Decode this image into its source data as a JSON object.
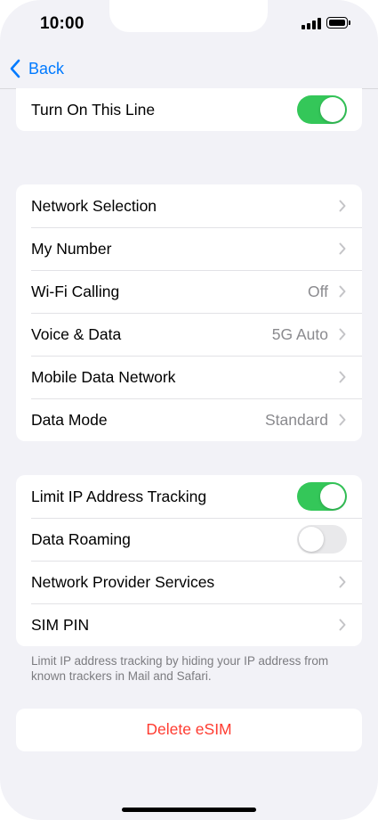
{
  "status_bar": {
    "time": "10:00",
    "signal_icon": "cellular-signal-icon",
    "battery_icon": "battery-icon"
  },
  "nav": {
    "back_label": "Back",
    "back_icon": "chevron-left-icon"
  },
  "colors": {
    "accent": "#007aff",
    "toggle_on": "#34c759",
    "toggle_off": "#e9e9eb",
    "destructive": "#ff3b30",
    "background": "#f2f2f7"
  },
  "line_group": {
    "rows": [
      {
        "label": "Turn On This Line",
        "toggle": true
      }
    ]
  },
  "network_group": {
    "rows": [
      {
        "label": "Network Selection",
        "value": ""
      },
      {
        "label": "My Number",
        "value": ""
      },
      {
        "label": "Wi-Fi Calling",
        "value": "Off"
      },
      {
        "label": "Voice & Data",
        "value": "5G Auto"
      },
      {
        "label": "Mobile Data Network",
        "value": ""
      },
      {
        "label": "Data Mode",
        "value": "Standard"
      }
    ]
  },
  "privacy_group": {
    "rows": [
      {
        "label": "Limit IP Address Tracking",
        "toggle": true
      },
      {
        "label": "Data Roaming",
        "toggle": false
      },
      {
        "label": "Network Provider Services",
        "value": ""
      },
      {
        "label": "SIM PIN",
        "value": ""
      }
    ],
    "footnote": "Limit IP address tracking by hiding your IP address from known trackers in Mail and Safari."
  },
  "delete": {
    "label": "Delete eSIM"
  }
}
